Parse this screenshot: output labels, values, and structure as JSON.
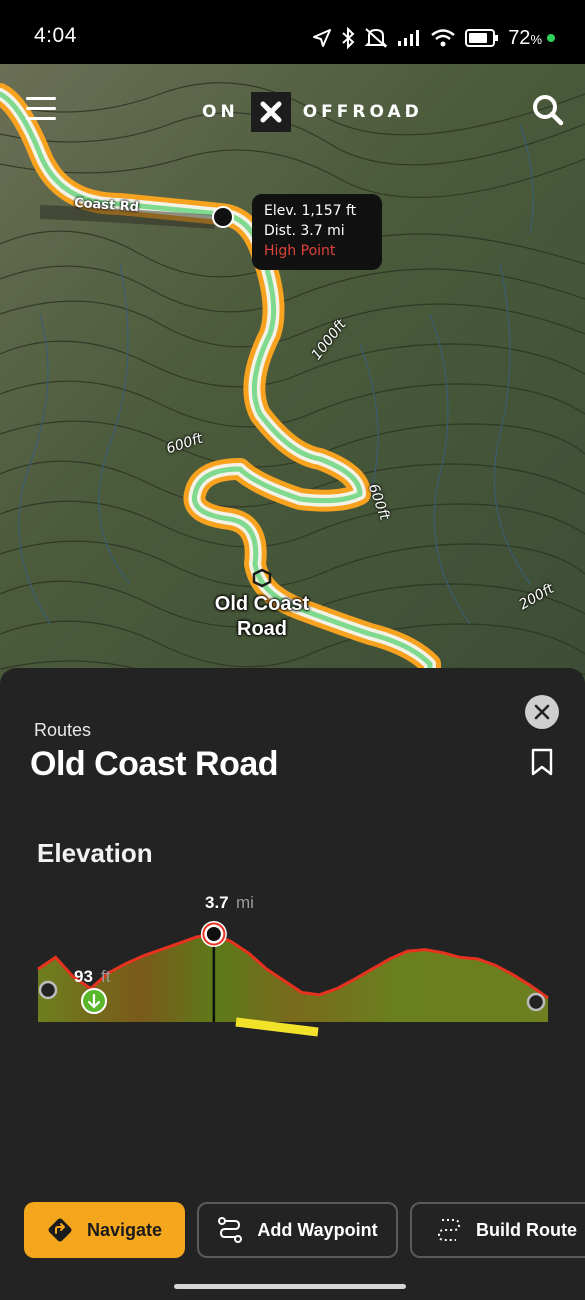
{
  "status_bar": {
    "time": "4:04",
    "battery_percent": "72",
    "battery_unit": "%",
    "icons": [
      "location-arrow-icon",
      "bluetooth-icon",
      "mute-icon",
      "signal-icon",
      "wifi-icon",
      "battery-icon"
    ]
  },
  "header": {
    "brand_left": "ON",
    "brand_mark": "X",
    "brand_right": "OFFROAD",
    "menu_icon": "hamburger-menu-icon",
    "search_icon": "search-icon"
  },
  "map": {
    "road_label": "Coast Rd",
    "contours": [
      "1000ft",
      "600ft",
      "600ft",
      "200ft"
    ],
    "tooltip": {
      "elevation": "Elev. 1,157 ft",
      "distance": "Dist. 3.7 mi",
      "marker": "High Point"
    },
    "poi_name": "Old Coast Road",
    "colors": {
      "route_outer": "#f7a320",
      "route_inner": "#7fd98e",
      "terrain": "#4e5a3f"
    }
  },
  "sheet": {
    "section": "Routes",
    "title": "Old Coast Road",
    "elevation_heading": "Elevation",
    "chart_data": {
      "type": "area",
      "title": "Elevation",
      "xlabel": "",
      "ylabel": "",
      "selected_point": {
        "distance_value": "3.7",
        "distance_unit": "mi"
      },
      "low_point": {
        "elevation_value": "93",
        "elevation_unit": "ft"
      },
      "series": [
        {
          "values": [
            0.55,
            0.7,
            0.45,
            0.3,
            0.5,
            0.62,
            0.72,
            0.8,
            0.88,
            0.96,
            1.0,
            0.9,
            0.75,
            0.55,
            0.4,
            0.25,
            0.22,
            0.3,
            0.42,
            0.55,
            0.68,
            0.78,
            0.8,
            0.76,
            0.7,
            0.68,
            0.6,
            0.48,
            0.34,
            0.18
          ]
        }
      ],
      "colors": {
        "line": "#e6321e",
        "fill": "#6b7a1c",
        "highlight": "#f2e32a"
      }
    }
  },
  "actions": {
    "navigate": "Navigate",
    "add_waypoint": "Add Waypoint",
    "build_route": "Build Route"
  }
}
